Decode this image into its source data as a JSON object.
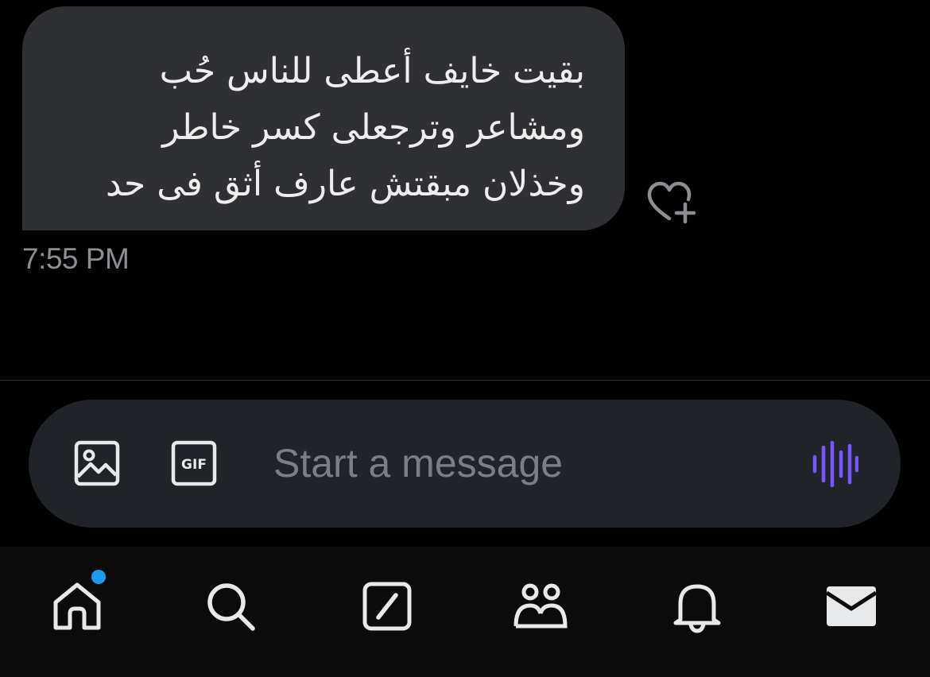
{
  "conversation": {
    "messages": [
      {
        "direction": "received",
        "lines": [
          "بقيت خايف أعطى للناس حُب",
          "ومشاعر وترجعلى كسر خاطر",
          "وخذلان مبقتش عارف أثق فى حد"
        ],
        "time": "7:55 PM",
        "react_icon": "heart-plus-icon"
      }
    ]
  },
  "composer": {
    "placeholder": "Start a message",
    "value": "",
    "image_icon": "image-icon",
    "gif_label": "GIF",
    "voice_icon": "voice-waveform-icon",
    "voice_color": "#7856ff"
  },
  "tabbar": {
    "items": [
      {
        "name": "home",
        "icon": "home-icon",
        "has_unread": true
      },
      {
        "name": "search",
        "icon": "search-icon"
      },
      {
        "name": "grok",
        "icon": "grok-icon"
      },
      {
        "name": "communities",
        "icon": "communities-icon"
      },
      {
        "name": "notifications",
        "icon": "bell-icon"
      },
      {
        "name": "messages",
        "icon": "envelope-icon",
        "active": true
      }
    ],
    "unread_dot_color": "#1d9bf0"
  }
}
